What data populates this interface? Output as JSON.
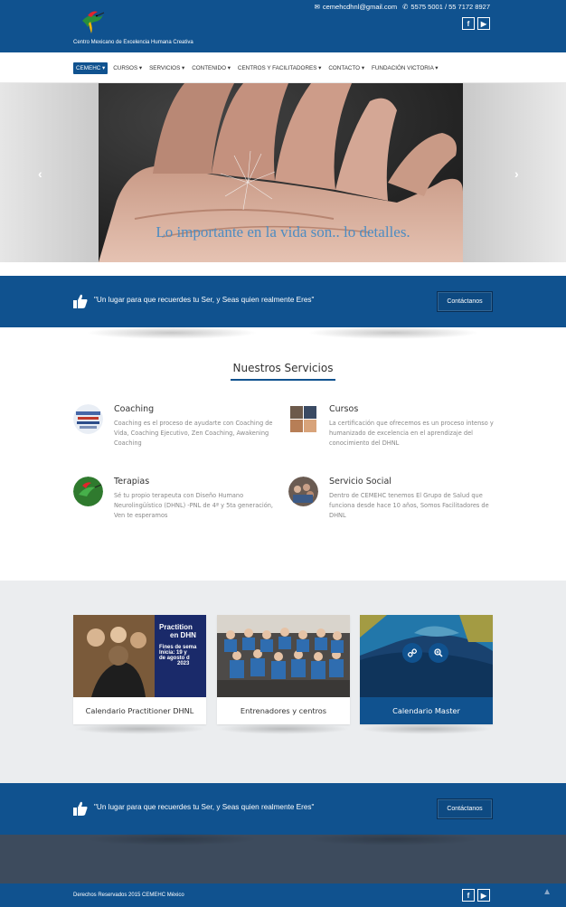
{
  "header": {
    "brand": "Centro Mexicano de Excelencia Humana Creativa",
    "email": "cemehcdhnl@gmail.com",
    "phone": "5575 5001 / 55 7172 8927",
    "email_icon": "envelope-icon",
    "phone_icon": "phone-icon"
  },
  "social": {
    "facebook": "f",
    "youtube": "▶"
  },
  "nav": {
    "items": [
      "CEMEHC",
      "CURSOS",
      "SERVICIOS",
      "CONTENIDO",
      "CENTROS Y FACILITADORES",
      "CONTACTO",
      "FUNDACIÓN VICTORIA"
    ],
    "caret": "▾"
  },
  "slider": {
    "caption": "Lo importante en la vida son.. lo detalles.",
    "prev": "‹",
    "next": "›",
    "slide_count": 10,
    "active_slide": 1
  },
  "banner": {
    "quote": "\"Un lugar para que recuerdes tu Ser, y Seas quien realmente Eres\"",
    "button": "Contáctanos"
  },
  "services": {
    "title": "Nuestros Servicios",
    "items": [
      {
        "name": "Coaching",
        "desc": "Coaching es el proceso de ayudarte con Coaching de Vida, Coaching Ejecutivo, Zen Coaching, Awakening Coaching"
      },
      {
        "name": "Cursos",
        "desc": "La certificación que ofrecemos es un proceso intenso y humanizado de excelencia en el aprendizaje del conocimiento del DHNL"
      },
      {
        "name": "Terapias",
        "desc": "Sé tu propio terapeuta con Diseño Humano Neurolingüístico (DHNL) -PNL de 4ª y 5ta generación, Ven te esperamos"
      },
      {
        "name": "Servicio Social",
        "desc": "Dentro de CEMEHC tenemos El Grupo de Salud que funciona desde hace 10 años, Somos Facilitadores de DHNL"
      }
    ]
  },
  "cards": [
    {
      "caption": "Calendario Practitioner DHNL",
      "poster": [
        "Practition",
        "en DHN",
        "Fines de sema",
        "Inicia: 19 y",
        "de agosto d",
        "2023"
      ]
    },
    {
      "caption": "Entrenadores y centros"
    },
    {
      "caption": "Calendario Master",
      "link_icon": "link-icon",
      "zoom_icon": "zoom-icon"
    }
  ],
  "footer": {
    "copyright": "Derechos Reservados 2015 CEMEHC México",
    "to_top": "▲"
  },
  "colors": {
    "primary": "#10528f",
    "dark": "#3d4b5d",
    "gray": "#ebedef"
  }
}
